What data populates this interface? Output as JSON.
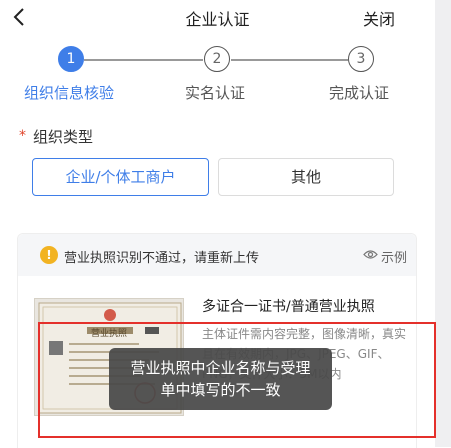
{
  "header": {
    "title": "企业认证",
    "close_label": "关闭"
  },
  "stepper": {
    "steps": [
      {
        "number": "1",
        "label": "组织信息核验",
        "active": true
      },
      {
        "number": "2",
        "label": "实名认证",
        "active": false
      },
      {
        "number": "3",
        "label": "完成认证",
        "active": false
      }
    ]
  },
  "org_type": {
    "required_mark": "*",
    "label": "组织类型",
    "options": [
      {
        "label": "企业/个体工商户",
        "selected": true
      },
      {
        "label": "其他",
        "selected": false
      }
    ]
  },
  "upload_card": {
    "alert_icon": "!",
    "alert_text": "营业执照识别不通过，请重新上传",
    "example_label": "示例",
    "doc_title": "多证合一证书/普通营业执照",
    "doc_description": "主体证件需内容完整，图像清晰，真实且在有效期内，JPG、JPEG、GIF、PNG，文件大小：5M以内",
    "thumb_heading": "营业执照"
  },
  "toast": {
    "line1": "营业执照中企业名称与受理",
    "line2": "单中填写的不一致"
  },
  "colors": {
    "accent": "#3f7ee8",
    "warning": "#f2b322",
    "error": "#e4302b"
  }
}
